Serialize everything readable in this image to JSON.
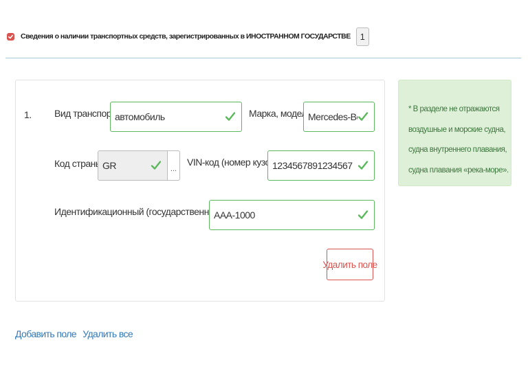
{
  "section": {
    "title": "Сведения о наличии транспортных средств, зарегистрированных в ИНОСТРАННОМ ГОСУДАРСТВЕ",
    "count": "1",
    "checked": true
  },
  "entry": {
    "number": "1.",
    "vehicle_type": {
      "label": "Вид транспорта",
      "value": "автомобиль"
    },
    "brand_model": {
      "label": "Марка, модель",
      "value": "Mercedes-Benz"
    },
    "country_code": {
      "label": "Код страны",
      "value": "GR",
      "button": "..."
    },
    "vin": {
      "label": "VIN-код (номер кузова)",
      "value": "1234567891234567"
    },
    "reg_number": {
      "label": "Идентификационный (государственный) номер",
      "value": "AAA-1000"
    },
    "delete_button": "Удалить поле"
  },
  "note": {
    "lines": [
      "* В разделе не отражаются",
      "воздушные и морские судна,",
      "судна внутреннего плавания,",
      "судна плавания «река-море»."
    ]
  },
  "actions": {
    "add": "Добавить поле",
    "delete_all": "Удалить все"
  },
  "colors": {
    "accent_red": "#d9534f",
    "valid_green": "#5cb85c",
    "note_bg": "#dff0d8",
    "link_blue": "#337ab7"
  },
  "icons": {
    "checkbox": "checkbox-checked-icon",
    "valid": "checkmark-icon"
  }
}
